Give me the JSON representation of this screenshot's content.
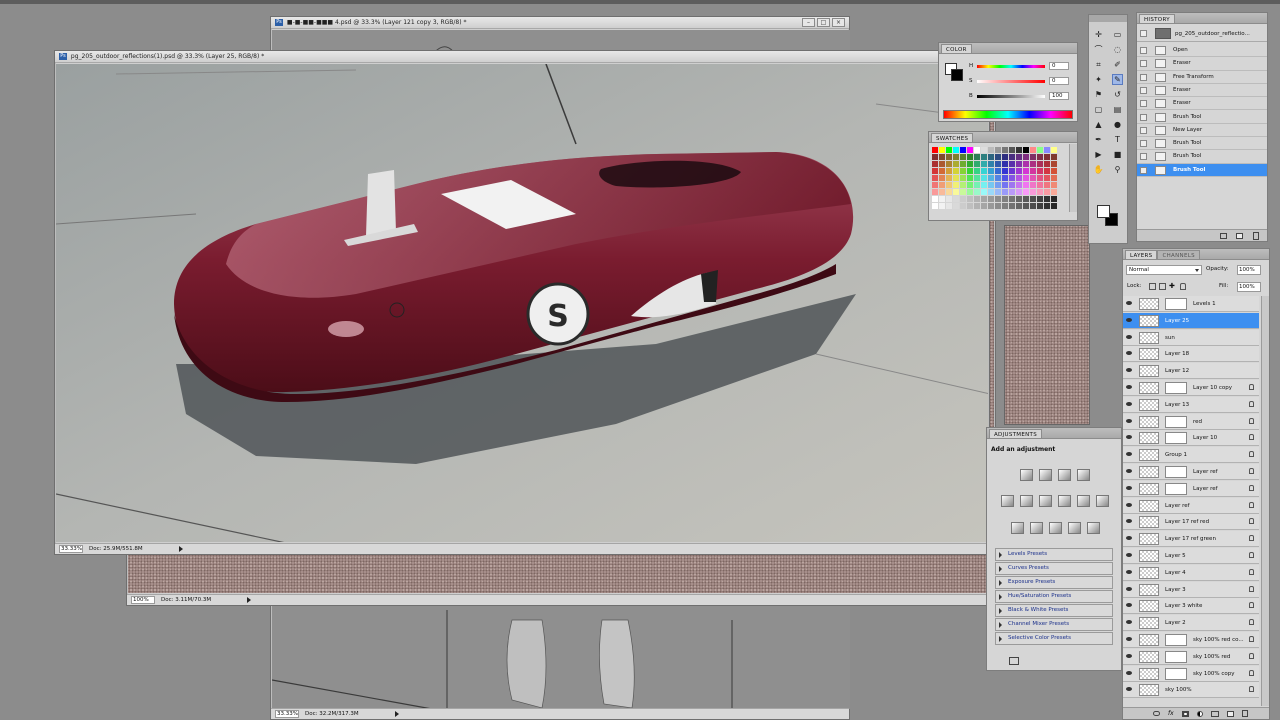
{
  "back_doc": {
    "title": "■-■-■■-■■■ 4.psd @ 33.3% (Layer 121 copy 3, RGB/8) *",
    "zoom": "33.33%",
    "doc_info": "Doc: 32.2M/317.3M"
  },
  "mid_doc": {
    "zoom": "100%",
    "doc_info": "Doc: 3.11M/70.3M"
  },
  "main_doc": {
    "title": "pg_205_outdoor_reflections(1).psd @ 33.3% (Layer 25, RGB/8) *",
    "zoom": "33.33%",
    "doc_info": "Doc: 25.9M/551.8M"
  },
  "color_panel": {
    "tab": "COLOR",
    "sliders": [
      {
        "label": "H",
        "value": "0"
      },
      {
        "label": "S",
        "value": "0"
      },
      {
        "label": "B",
        "value": "100"
      }
    ]
  },
  "swatches_panel": {
    "tab": "SWATCHES"
  },
  "history_panel": {
    "tab": "HISTORY",
    "snapshot": "pg_205_outdoor_reflectio...",
    "items": [
      {
        "name": "Open",
        "selected": false
      },
      {
        "name": "Eraser",
        "selected": false
      },
      {
        "name": "Free Transform",
        "selected": false
      },
      {
        "name": "Eraser",
        "selected": false
      },
      {
        "name": "Eraser",
        "selected": false
      },
      {
        "name": "Brush Tool",
        "selected": false
      },
      {
        "name": "New Layer",
        "selected": false
      },
      {
        "name": "Brush Tool",
        "selected": false
      },
      {
        "name": "Brush Tool",
        "selected": false
      },
      {
        "name": "Brush Tool",
        "selected": true
      }
    ]
  },
  "layers_panel": {
    "tabs": [
      "LAYERS",
      "CHANNELS"
    ],
    "blend_mode": "Normal",
    "opacity_label": "Opacity:",
    "opacity": "100%",
    "lock_label": "Lock:",
    "fill_label": "Fill:",
    "fill": "100%",
    "layers": [
      {
        "name": "Levels 1",
        "mask": true,
        "selected": false
      },
      {
        "name": "Layer 25",
        "mask": false,
        "selected": true
      },
      {
        "name": "sun",
        "mask": false,
        "selected": false
      },
      {
        "name": "Layer 18",
        "mask": false,
        "selected": false
      },
      {
        "name": "Layer 12",
        "mask": false,
        "selected": false
      },
      {
        "name": "Layer 10 copy",
        "mask": true,
        "selected": false
      },
      {
        "name": "Layer 13",
        "mask": false,
        "selected": false
      },
      {
        "name": "red",
        "mask": true,
        "selected": false
      },
      {
        "name": "Layer 10",
        "mask": true,
        "selected": false
      },
      {
        "name": "Group 1",
        "mask": false,
        "selected": false
      },
      {
        "name": "Layer ref",
        "mask": true,
        "selected": false
      },
      {
        "name": "Layer ref",
        "mask": true,
        "selected": false
      },
      {
        "name": "Layer ref",
        "mask": false,
        "selected": false
      },
      {
        "name": "Layer 17 ref red",
        "mask": false,
        "selected": false
      },
      {
        "name": "Layer 17 ref green",
        "mask": false,
        "selected": false
      },
      {
        "name": "Layer 5",
        "mask": false,
        "selected": false
      },
      {
        "name": "Layer 4",
        "mask": false,
        "selected": false
      },
      {
        "name": "Layer 3",
        "mask": false,
        "selected": false
      },
      {
        "name": "Layer 3 white",
        "mask": false,
        "selected": false
      },
      {
        "name": "Layer 2",
        "mask": false,
        "selected": false
      },
      {
        "name": "sky 100% red co...",
        "mask": true,
        "selected": false
      },
      {
        "name": "sky 100% red",
        "mask": true,
        "selected": false
      },
      {
        "name": "sky 100% copy",
        "mask": true,
        "selected": false
      },
      {
        "name": "sky 100%",
        "mask": false,
        "selected": false
      }
    ]
  },
  "adjustments_panel": {
    "tab": "ADJUSTMENTS",
    "heading": "Add an adjustment",
    "presets": [
      "Levels Presets",
      "Curves Presets",
      "Exposure Presets",
      "Hue/Saturation Presets",
      "Black & White Presets",
      "Channel Mixer Presets",
      "Selective Color Presets"
    ]
  },
  "canvas": {
    "badge_letter": "S"
  }
}
